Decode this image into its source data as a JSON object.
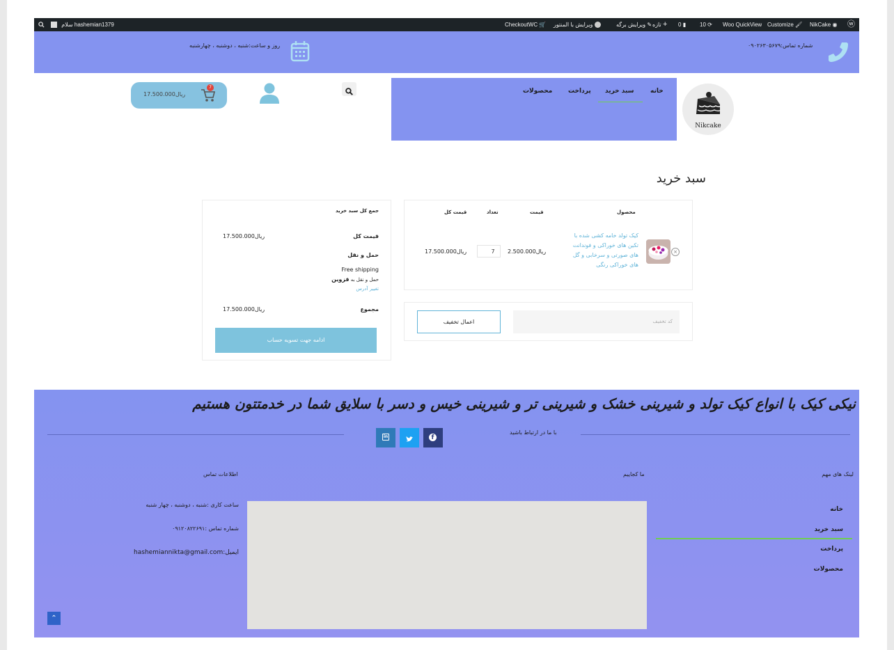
{
  "admin_bar": {
    "greeting": "سلام hashemian1379",
    "site_name": "NikCake",
    "customize": "Customize",
    "woo_quickview": "Woo QuickView",
    "updates_count": "10",
    "comments_count": "0",
    "new_label": "تازه",
    "edit_page": "ویرایش برگه",
    "edit_elementor": "ویرایش با المنتور",
    "checkoutwc": "CheckoutWC"
  },
  "top_bar": {
    "phone": "شماره تماس:۰۹۰۲۶۳۰۵۶۷۹",
    "hours": "روز و ساعت:شنبه ، دوشنبه ، چهارشنبه"
  },
  "header": {
    "menu": [
      "خانه",
      "سبد خرید",
      "پرداخت",
      "محصولات"
    ],
    "logo_text": "Nikcake",
    "cart_total": "17.500.000ریال",
    "cart_count": "7"
  },
  "cart": {
    "title": "سبد خرید",
    "columns": [
      "محصول",
      "قیمت",
      "تعداد",
      "قیمت کل"
    ],
    "item": {
      "name_lines": [
        "کیک تولد خامه کشی شده با",
        "تکین های خوراکی و فوندانت",
        "های صورتی و سرخابی و گل",
        "های خوراکی رنگی"
      ],
      "price": "2.500.000ریال",
      "quantity": "7",
      "subtotal": "17.500.000ریال"
    },
    "coupon_placeholder": "کد تخفیف",
    "apply_coupon": "اعمال تخفیف"
  },
  "totals": {
    "title": "جمع کل سبد خرید",
    "subtotal_label": "قیمت کل",
    "subtotal_value": "17.500.000ریال",
    "shipping_label": "حمل و نقل",
    "shipping_method": "Free shipping",
    "shipping_to_prefix": "حمل و نقل به",
    "shipping_to_city": "قزوین",
    "change_address": "تغییر آدرس",
    "total_label": "مجموع",
    "total_value": "17.500.000ریال",
    "checkout_button": "ادامه جهت تسویه حساب"
  },
  "footer": {
    "slogan": "نیکی کیک با انواع کیک تولد و شیرینی خشک و شیرینی تر و شیرینی خیس و دسر  با سلایق شما در خدمتتون هستیم",
    "contact_us": "با ما در ارتباط باشید",
    "important_links": "لینک های مهم",
    "where_we_are": "ما کجاییم",
    "contact_info": "اطلاعات تماس",
    "links": [
      "خانه",
      "سبد خرید",
      "پرداخت",
      "محصولات"
    ],
    "work_hours": "ساعت کاری :شنبه ، دوشنبه ، چهار شنبه",
    "phone": "شماره تماس :۰۹۱۲۰۸۲۲۶۹۱",
    "email": "hashemiannikta@gmail.com:ایمیل"
  },
  "colors": {
    "accent_blue": "#8493f0",
    "link_blue": "#5fb3d8",
    "active_green": "#6fcf4f"
  }
}
